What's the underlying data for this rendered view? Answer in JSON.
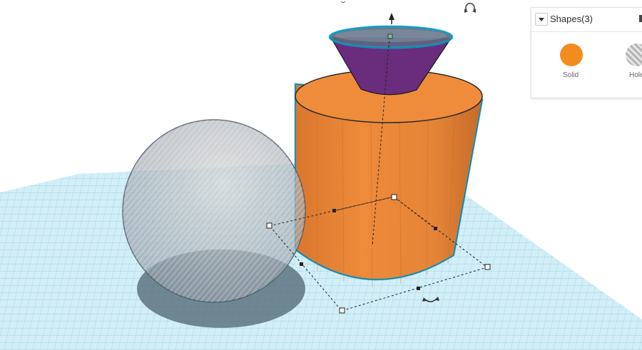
{
  "panel": {
    "title": "Shapes(3)",
    "solid_label": "Solid",
    "hole_label": "Hole",
    "solid_color": "#f28c1f",
    "hole_pattern": "striped-gray"
  },
  "scene": {
    "workplane_color": "#d3eef7",
    "grid_color": "#7fc6dd",
    "cylinder_color": "#e8863a",
    "cone_color": "#6d2e7f",
    "sphere_style": "transparent-hole",
    "selection_outline": "#00aadd",
    "icons": [
      "move-up-arrow-icon",
      "rotate-icon",
      "rotate-handle-icon"
    ]
  }
}
